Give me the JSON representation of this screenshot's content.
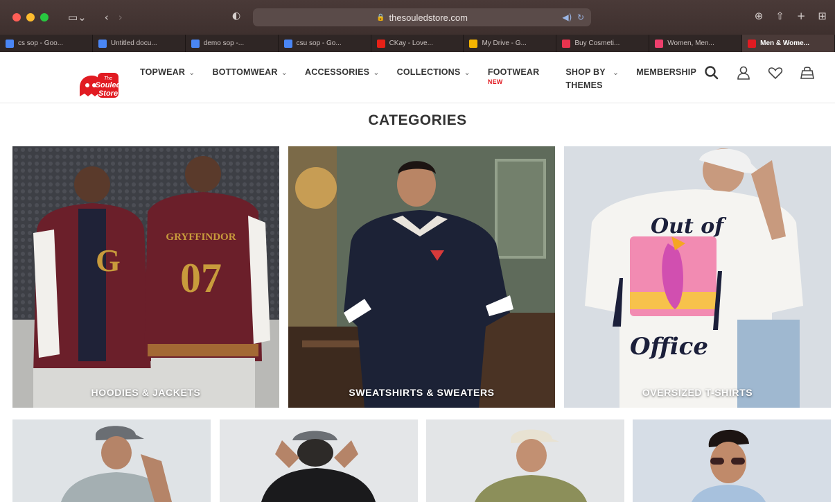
{
  "browser": {
    "url": "thesouledstore.com",
    "tabs": [
      {
        "label": "cs sop - Goo...",
        "favicon": "docs-icon",
        "color": "#4a86f5"
      },
      {
        "label": "Untitled docu...",
        "favicon": "docs-icon",
        "color": "#4a86f5"
      },
      {
        "label": "demo sop -...",
        "favicon": "docs-icon",
        "color": "#4a86f5"
      },
      {
        "label": "csu sop - Go...",
        "favicon": "docs-icon",
        "color": "#4a86f5"
      },
      {
        "label": "CKay - Love...",
        "favicon": "youtube-icon",
        "color": "#e62117"
      },
      {
        "label": "My Drive - G...",
        "favicon": "drive-icon",
        "color": "#f4b400"
      },
      {
        "label": "Buy Cosmeti...",
        "favicon": "nykaa-icon",
        "color": "#e8344e"
      },
      {
        "label": "Women, Men...",
        "favicon": "myntra-icon",
        "color": "#ee3f6c"
      },
      {
        "label": "Men & Wome...",
        "favicon": "souled-store-icon",
        "color": "#e11b22",
        "active": true
      }
    ]
  },
  "header": {
    "logo_text": "The Souled Store",
    "nav": [
      {
        "label": "TOPWEAR",
        "chevron": true
      },
      {
        "label": "BOTTOMWEAR",
        "chevron": true
      },
      {
        "label": "ACCESSORIES",
        "chevron": true
      },
      {
        "label": "COLLECTIONS",
        "chevron": true
      },
      {
        "label": "FOOTWEAR",
        "badge": "NEW"
      },
      {
        "label": "SHOP BY",
        "label2": "THEMES",
        "chevron": true
      },
      {
        "label": "MEMBERSHIP"
      }
    ],
    "icons": [
      "search-icon",
      "user-icon",
      "heart-icon",
      "bag-icon"
    ]
  },
  "categories": {
    "title": "CATEGORIES",
    "row1": [
      {
        "label": "HOODIES & JACKETS"
      },
      {
        "label": "SWEATSHIRTS & SWEATERS"
      },
      {
        "label": "OVERSIZED T-SHIRTS"
      }
    ],
    "row2_count": 4
  },
  "colors": {
    "brand_red": "#e11b22",
    "text_dark": "#333333"
  }
}
